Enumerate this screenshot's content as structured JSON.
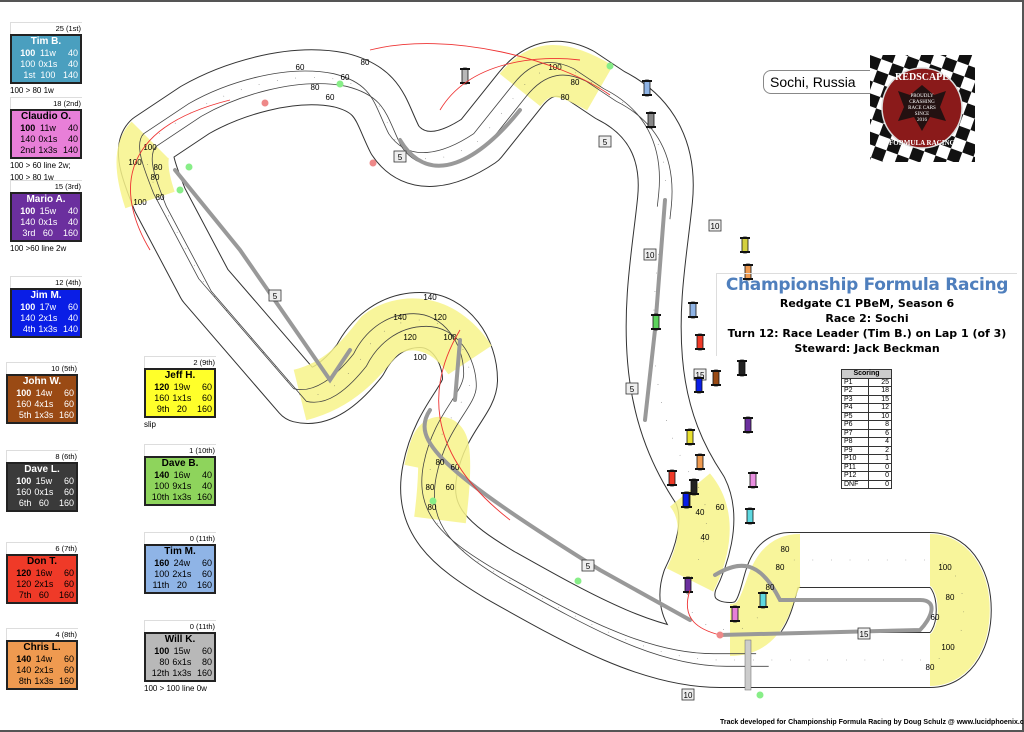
{
  "location": "Sochi, Russia",
  "logo": {
    "top_text": "REDSCAPE",
    "middle_lines": [
      "PROUDLY",
      "CRASHING",
      "RACE CARS",
      "SINCE",
      "2016"
    ],
    "bottom_text": "FORMULA RACING"
  },
  "title": {
    "main": "Championship Formula Racing",
    "line1": "Redgate C1 PBeM, Season 6",
    "line2": "Race 2: Sochi",
    "line3": "Turn 12: Race Leader (Tim B.) on Lap 1 (of 3)",
    "line4": "Steward: Jack Beckman"
  },
  "scoring": {
    "header": "Scoring",
    "rows": [
      {
        "pos": "P1",
        "pts": "25"
      },
      {
        "pos": "P2",
        "pts": "18"
      },
      {
        "pos": "P3",
        "pts": "15"
      },
      {
        "pos": "P4",
        "pts": "12"
      },
      {
        "pos": "P5",
        "pts": "10"
      },
      {
        "pos": "P6",
        "pts": "8"
      },
      {
        "pos": "P7",
        "pts": "6"
      },
      {
        "pos": "P8",
        "pts": "4"
      },
      {
        "pos": "P9",
        "pts": "2"
      },
      {
        "pos": "P10",
        "pts": "1"
      },
      {
        "pos": "P11",
        "pts": "0"
      },
      {
        "pos": "P12",
        "pts": "0"
      },
      {
        "pos": "DNF",
        "pts": "0"
      }
    ]
  },
  "drivers": [
    {
      "points": "25 (1st)",
      "name": "Tim B.",
      "color": "#4a9fbf",
      "light": true,
      "r1": [
        "100",
        "11w",
        "40"
      ],
      "r2": [
        "100",
        "0x1s",
        "40"
      ],
      "r3": [
        "1st",
        "100",
        "140"
      ],
      "notes": [
        "100 > 80 1w"
      ]
    },
    {
      "points": "18 (2nd)",
      "name": "Claudio O.",
      "color": "#e87fd8",
      "light": false,
      "r1": [
        "100",
        "11w",
        "40"
      ],
      "r2": [
        "140",
        "0x1s",
        "40"
      ],
      "r3": [
        "2nd",
        "1x3s",
        "140"
      ],
      "notes": [
        "100 > 60 line 2w;",
        "100 > 80 1w"
      ]
    },
    {
      "points": "15 (3rd)",
      "name": "Mario A.",
      "color": "#6b2f9e",
      "light": true,
      "r1": [
        "100",
        "15w",
        "40"
      ],
      "r2": [
        "140",
        "0x1s",
        "40"
      ],
      "r3": [
        "3rd",
        "60",
        "160"
      ],
      "notes": [
        "100 >60 line 2w"
      ]
    },
    {
      "points": "12 (4th)",
      "name": "Jim M.",
      "color": "#0a1ee6",
      "light": true,
      "r1": [
        "100",
        "17w",
        "60"
      ],
      "r2": [
        "140",
        "2x1s",
        "40"
      ],
      "r3": [
        "4th",
        "1x3s",
        "140"
      ],
      "notes": []
    },
    {
      "points": "10 (5th)",
      "name": "John W.",
      "color": "#9a4a14",
      "light": true,
      "r1": [
        "100",
        "14w",
        "60"
      ],
      "r2": [
        "160",
        "4x1s",
        "60"
      ],
      "r3": [
        "5th",
        "1x3s",
        "160"
      ],
      "notes": []
    },
    {
      "points": "8 (6th)",
      "name": "Dave L.",
      "color": "#3a3a3a",
      "light": true,
      "r1": [
        "100",
        "15w",
        "60"
      ],
      "r2": [
        "160",
        "0x1s",
        "60"
      ],
      "r3": [
        "6th",
        "60",
        "160"
      ],
      "notes": []
    },
    {
      "points": "6 (7th)",
      "name": "Don T.",
      "color": "#ef3a28",
      "light": false,
      "r1": [
        "120",
        "16w",
        "60"
      ],
      "r2": [
        "120",
        "2x1s",
        "60"
      ],
      "r3": [
        "7th",
        "60",
        "160"
      ],
      "notes": []
    },
    {
      "points": "4 (8th)",
      "name": "Chris L.",
      "color": "#ef9a50",
      "light": false,
      "r1": [
        "140",
        "14w",
        "60"
      ],
      "r2": [
        "140",
        "2x1s",
        "60"
      ],
      "r3": [
        "8th",
        "1x3s",
        "160"
      ],
      "notes": []
    },
    {
      "points": "2 (9th)",
      "name": "Jeff H.",
      "color": "#ffff2a",
      "light": false,
      "r1": [
        "120",
        "19w",
        "60"
      ],
      "r2": [
        "160",
        "1x1s",
        "60"
      ],
      "r3": [
        "9th",
        "20",
        "160"
      ],
      "notes": [
        "slip"
      ]
    },
    {
      "points": "1 (10th)",
      "name": "Dave B.",
      "color": "#8ed45c",
      "light": false,
      "r1": [
        "140",
        "16w",
        "40"
      ],
      "r2": [
        "100",
        "9x1s",
        "40"
      ],
      "r3": [
        "10th",
        "1x3s",
        "160"
      ],
      "notes": []
    },
    {
      "points": "0 (11th)",
      "name": "Tim M.",
      "color": "#8fb4e6",
      "light": false,
      "r1": [
        "160",
        "24w",
        "60"
      ],
      "r2": [
        "100",
        "2x1s",
        "60"
      ],
      "r3": [
        "11th",
        "20",
        "160"
      ],
      "notes": []
    },
    {
      "points": "0 (11th)",
      "name": "Will K.",
      "color": "#b8b8b8",
      "light": false,
      "r1": [
        "100",
        "15w",
        "60"
      ],
      "r2": [
        "80",
        "6x1s",
        "80"
      ],
      "r3": [
        "12th",
        "1x3s",
        "160"
      ],
      "notes": [
        "100 > 100 line 0w"
      ]
    }
  ],
  "track": {
    "corner_speed_labels": [
      {
        "text": "100"
      },
      {
        "text": "80"
      },
      {
        "text": "100"
      },
      {
        "text": "80"
      },
      {
        "text": "100"
      },
      {
        "text": "80"
      },
      {
        "text": "60"
      },
      {
        "text": "80"
      },
      {
        "text": "60"
      },
      {
        "text": "60"
      },
      {
        "text": "80"
      },
      {
        "text": "100"
      },
      {
        "text": "80"
      },
      {
        "text": "80"
      },
      {
        "text": "140"
      },
      {
        "text": "120"
      },
      {
        "text": "100"
      },
      {
        "text": "140"
      },
      {
        "text": "120"
      },
      {
        "text": "100"
      },
      {
        "text": "80"
      },
      {
        "text": "60"
      },
      {
        "text": "80"
      },
      {
        "text": "60"
      },
      {
        "text": "80"
      },
      {
        "text": "40"
      },
      {
        "text": "60"
      },
      {
        "text": "40"
      },
      {
        "text": "80"
      },
      {
        "text": "80"
      },
      {
        "text": "80"
      },
      {
        "text": "100"
      },
      {
        "text": "80"
      },
      {
        "text": "60"
      },
      {
        "text": "100"
      },
      {
        "text": "80"
      }
    ],
    "distance_markers": [
      "5",
      "5",
      "10",
      "10",
      "5",
      "5",
      "5",
      "15",
      "10",
      "15"
    ]
  },
  "footer": "Track developed for Championship Formula Racing by Doug Schulz @ www.lucidphoenix.com"
}
